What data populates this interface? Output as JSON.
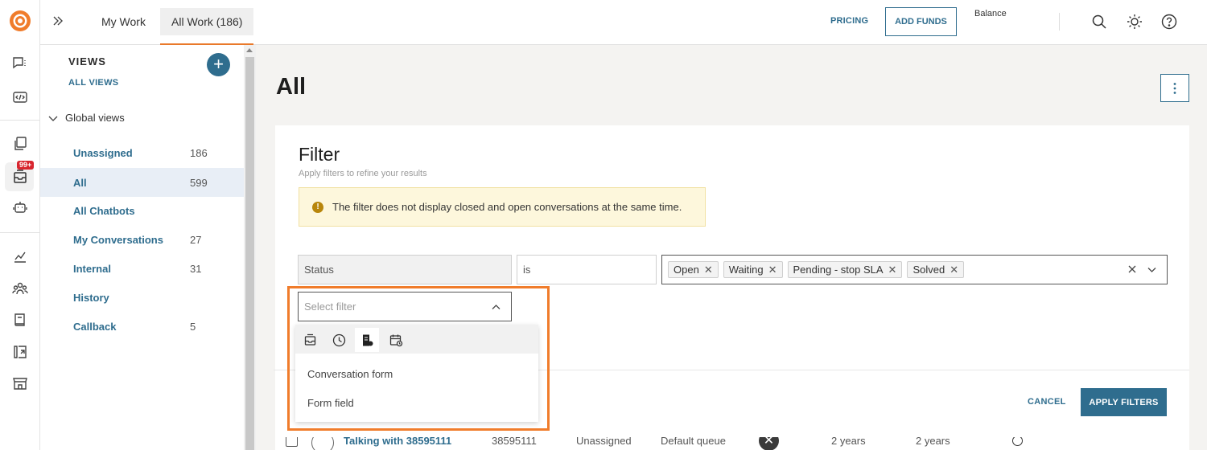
{
  "topbar": {
    "tabs": [
      {
        "label": "My Work"
      },
      {
        "label": "All Work (186)"
      }
    ],
    "pricing": "PRICING",
    "add_funds": "ADD FUNDS",
    "balance": "Balance"
  },
  "rail": {
    "badge": "99+"
  },
  "views": {
    "title": "VIEWS",
    "all_views": "ALL VIEWS",
    "group_label": "Global views",
    "items": [
      {
        "label": "Unassigned",
        "count": "186"
      },
      {
        "label": "All",
        "count": "599"
      },
      {
        "label": "All Chatbots",
        "count": ""
      },
      {
        "label": "My Conversations",
        "count": "27"
      },
      {
        "label": "Internal",
        "count": "31"
      },
      {
        "label": "History",
        "count": ""
      },
      {
        "label": "Callback",
        "count": "5"
      }
    ]
  },
  "main": {
    "title": "All"
  },
  "filter": {
    "title": "Filter",
    "subtitle": "Apply filters to refine your results",
    "warning": "The filter does not display closed and open conversations at the same time.",
    "field": "Status",
    "operator": "is",
    "values": [
      "Open",
      "Waiting",
      "Pending - stop SLA",
      "Solved"
    ],
    "select_placeholder": "Select filter",
    "menu_items": [
      "Conversation form",
      "Form field"
    ],
    "cancel": "CANCEL",
    "apply": "APPLY FILTERS"
  },
  "table_peek": {
    "name": "Talking with 38595111",
    "id": "38595111",
    "assignee": "Unassigned",
    "queue": "Default queue",
    "created": "2 years",
    "updated": "2 years"
  },
  "colors": {
    "accent": "#2f6d8e",
    "highlight": "#f07c2b",
    "badge": "#d8252e"
  }
}
